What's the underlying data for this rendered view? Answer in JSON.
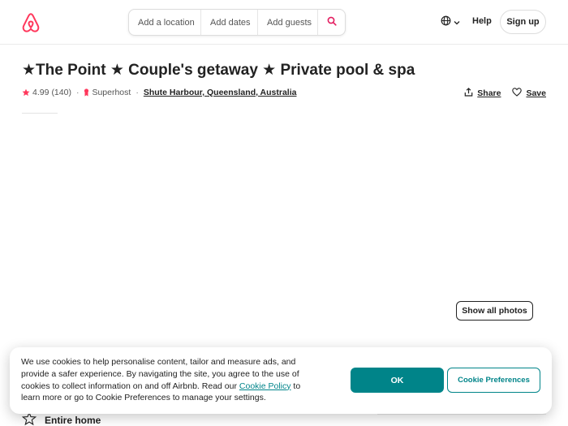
{
  "header": {
    "search": {
      "location_placeholder": "Add a location",
      "dates_placeholder": "Add dates",
      "guests_placeholder": "Add guests"
    },
    "help_label": "Help",
    "signup_label": "Sign up"
  },
  "listing": {
    "title": "★The Point ★ Couple's getaway ★ Private pool & spa",
    "rating": "4.99",
    "reviews": "(140)",
    "superhost": "Superhost",
    "location": "Shute Harbour, Queensland, Australia",
    "share_label": "Share",
    "save_label": "Save",
    "show_photos_label": "Show all photos",
    "property_type": "Entire home"
  },
  "cookie_banner": {
    "text_before": "We use cookies to help personalise content, tailor and measure ads, and provide a safer experience. By navigating the site, you agree to the use of cookies to collect information on and off Airbnb. Read our ",
    "policy_link": "Cookie Policy",
    "text_after": " to learn more or go to Cookie Preferences to manage your settings.",
    "ok_label": "OK",
    "prefs_label": "Cookie Preferences"
  },
  "colors": {
    "brand": "#FF385C",
    "teal": "#008489",
    "text": "#222222"
  },
  "icons": [
    "airbnb-logo",
    "search-icon",
    "globe-icon",
    "chevron-down-icon",
    "star-icon",
    "superhost-icon",
    "share-icon",
    "heart-icon",
    "home-icon"
  ]
}
